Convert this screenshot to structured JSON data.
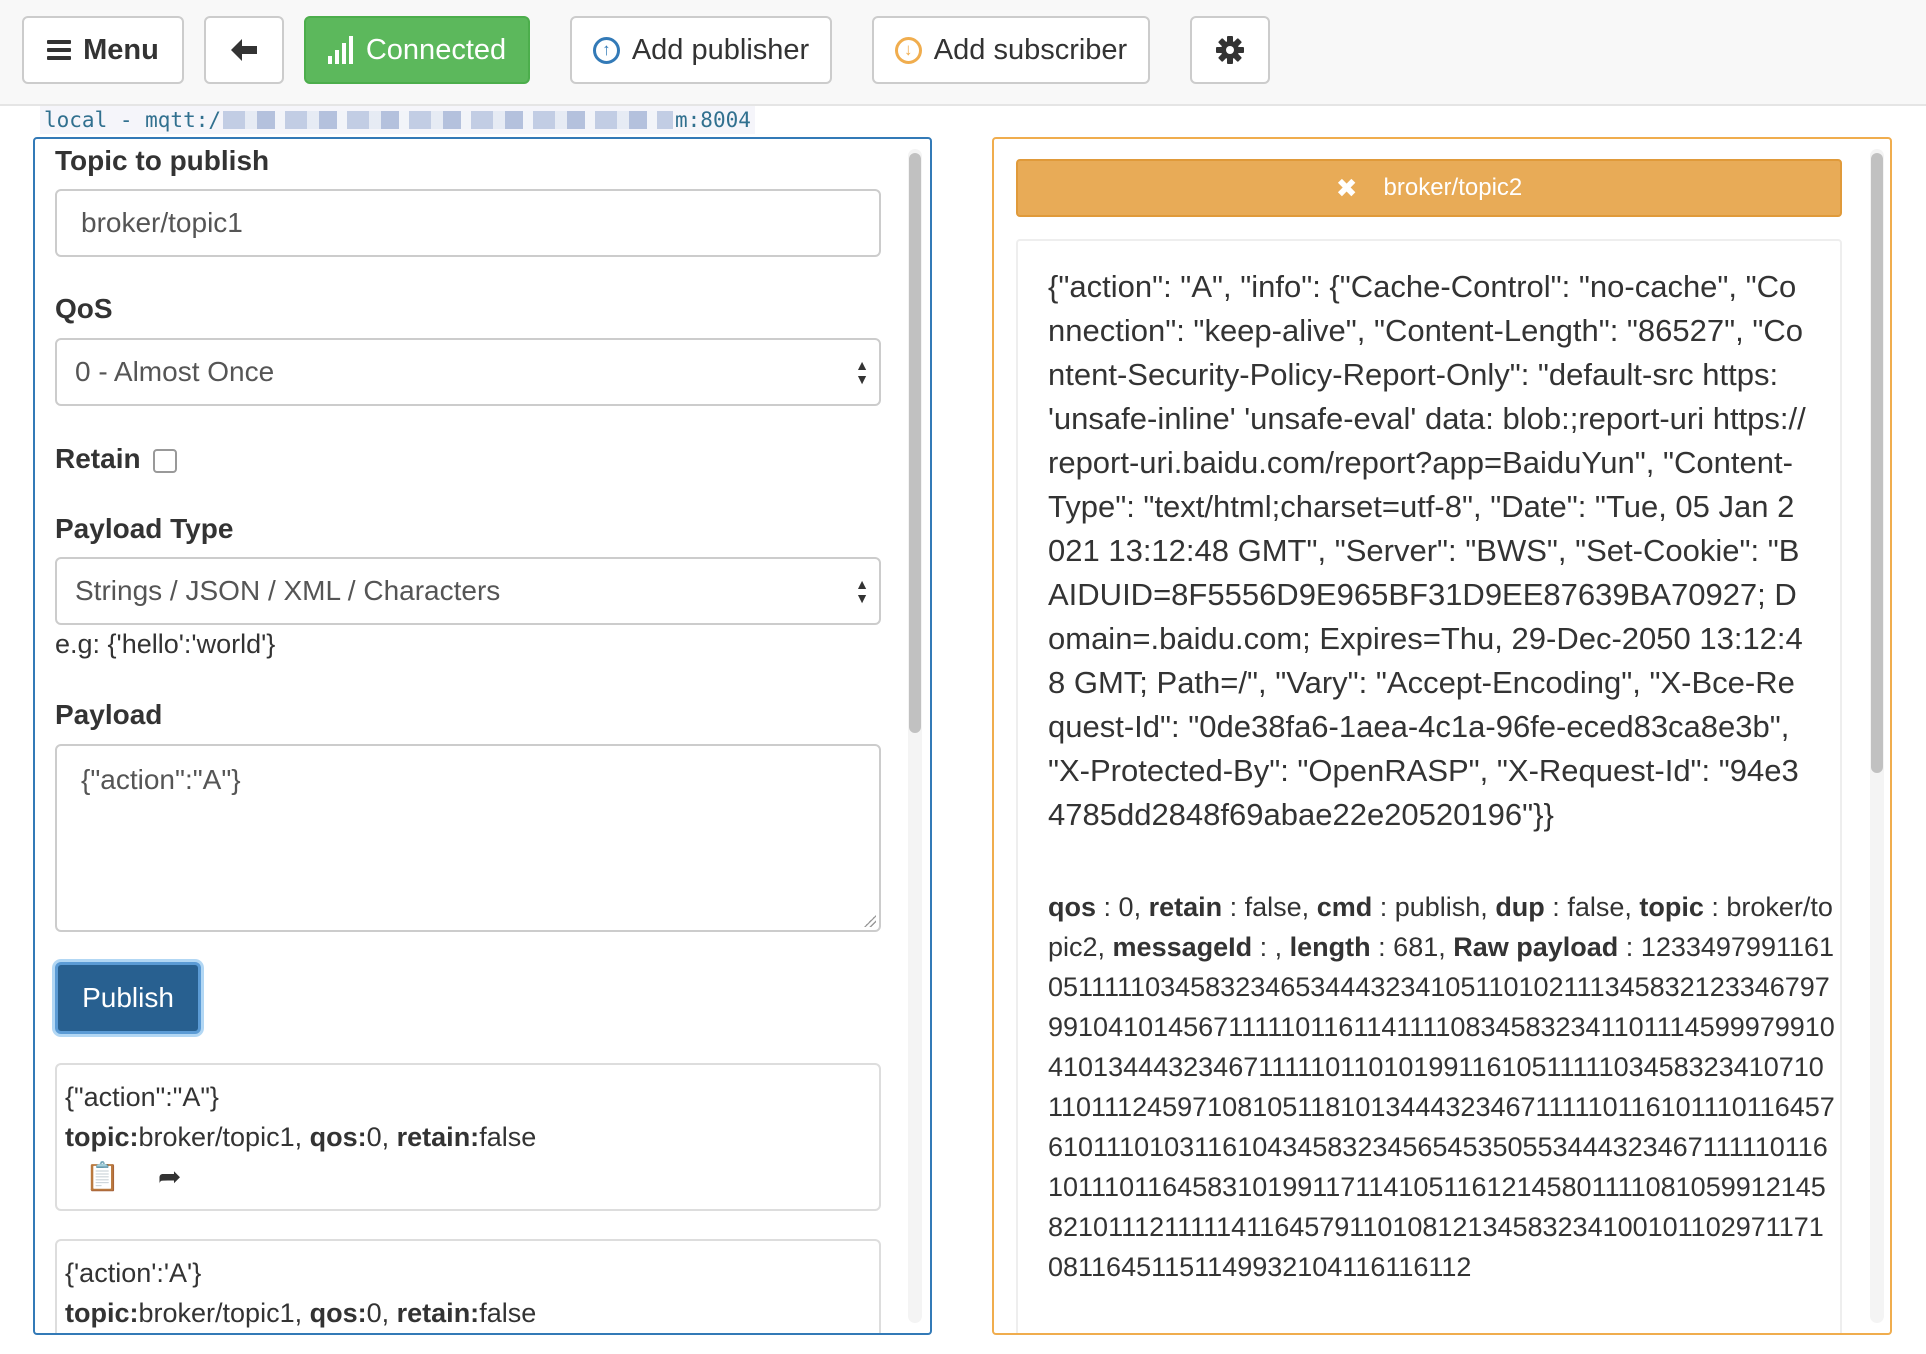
{
  "toolbar": {
    "menu_label": "Menu",
    "connected_label": "Connected",
    "add_publisher_label": "Add publisher",
    "add_subscriber_label": "Add subscriber"
  },
  "connection": {
    "prefix": "local - mqtt:/",
    "suffix": "m:8004"
  },
  "publisher": {
    "topic_label": "Topic to publish",
    "topic_value": "broker/topic1",
    "qos_label": "QoS",
    "qos_value": "0 - Almost Once",
    "retain_label": "Retain",
    "retain_checked": false,
    "payload_type_label": "Payload Type",
    "payload_type_value": "Strings / JSON / XML / Characters",
    "payload_help": "e.g: {'hello':'world'}",
    "payload_label": "Payload",
    "payload_value": "{\"action\":\"A\"}",
    "publish_label": "Publish",
    "history": [
      {
        "message": "{\"action\":\"A\"}",
        "topic_key": "topic:",
        "topic": "broker/topic1",
        "qos_key": "qos:",
        "qos": "0",
        "retain_key": "retain:",
        "retain": "false"
      },
      {
        "message": "{'action':'A'}",
        "topic_key": "topic:",
        "topic": "broker/topic1",
        "qos_key": "qos:",
        "qos": "0",
        "retain_key": "retain:",
        "retain": "false"
      }
    ]
  },
  "subscriber": {
    "topic": "broker/topic2",
    "payload": "{\"action\": \"A\", \"info\": {\"Cache-Control\": \"no-cache\", \"Connection\": \"keep-alive\", \"Content-Length\": \"86527\", \"Content-Security-Policy-Report-Only\": \"default-src https: 'unsafe-inline' 'unsafe-eval' data: blob:;report-uri https://report-uri.baidu.com/report?app=BaiduYun\", \"Content-Type\": \"text/html;charset=utf-8\", \"Date\": \"Tue, 05 Jan 2021 13:12:48 GMT\", \"Server\": \"BWS\", \"Set-Cookie\": \"BAIDUID=8F5556D9E965BF31D9EE87639BA70927; Domain=.baidu.com; Expires=Thu, 29-Dec-2050 13:12:48 GMT; Path=/\", \"Vary\": \"Accept-Encoding\", \"X-Bce-Request-Id\": \"0de38fa6-1aea-4c1a-96fe-eced83ca8e3b\", \"X-Protected-By\": \"OpenRASP\", \"X-Request-Id\": \"94e34785dd2848f69abae22e20520196\"}}",
    "meta": {
      "qos_key": "qos",
      "qos": "0",
      "retain_key": "retain",
      "retain": "false",
      "cmd_key": "cmd",
      "cmd": "publish",
      "dup_key": "dup",
      "dup": "false",
      "topic_key": "topic",
      "topic": "broker/topic2",
      "messageid_key": "messageId",
      "messageid": "",
      "length_key": "length",
      "length": "681",
      "raw_key": "Raw payload",
      "raw": "1233497991161051111103458323465344432341051101021113458321233467979910410145671111101161141111083458323411011145999799104101344432346711111011010199116105111110345832341071011011124597108105118101344432346711111011610111011645761011101031161043458323456545350553444323467111110116101110116458310199117114105116121458011110810599121458210111211111411645791101081213458323410010110297117108116451151149932104116116112"
    }
  },
  "colors": {
    "connected": "#5cb85c",
    "publisher_border": "#337ab7",
    "subscriber_border": "#f0ad4e",
    "subscriber_header": "#e8ab57",
    "publish_button": "#286090"
  },
  "icons": [
    "hamburger-icon",
    "arrow-left-icon",
    "signal-icon",
    "arrow-up-circle-icon",
    "arrow-down-circle-icon",
    "gear-icon",
    "clipboard-icon",
    "share-icon",
    "close-icon"
  ]
}
